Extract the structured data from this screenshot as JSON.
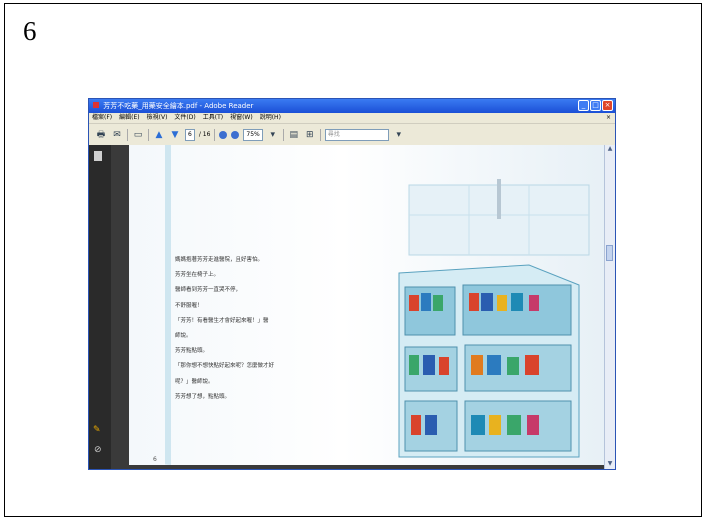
{
  "page_number": "6",
  "window": {
    "title": "芳芳不吃藥_用藥安全繪本.pdf - Adobe Reader",
    "controls": {
      "minimize": "_",
      "maximize": "□",
      "close": "×"
    }
  },
  "menu": [
    "檔案(F)",
    "編輯(E)",
    "檢視(V)",
    "文件(D)",
    "工具(T)",
    "視窗(W)",
    "說明(H)"
  ],
  "menu_close": "×",
  "toolbar": {
    "page_current": "6",
    "page_total": "/ 16",
    "zoom": "75%",
    "search_placeholder": "尋找"
  },
  "document": {
    "lines": [
      "媽媽抱著芳芳走進醫院，且好害怕。",
      "芳芳坐在椅子上。",
      "醫師看到芳芳一直哭不停，",
      "不舒服喔！",
      "「芳芳！有看醫生才會好起來喔！」醫",
      "師說。",
      "芳芳點點頭。",
      "「那你想不想快點好起來呢？怎麼做才好",
      "呢？」醫師說。",
      "芳芳想了想，點點頭。"
    ],
    "footer_page": "6"
  },
  "colors": {
    "titlebar": "#1b4fd6",
    "sidebar": "#2a2a2a",
    "shelf": "#6fb2cc"
  }
}
